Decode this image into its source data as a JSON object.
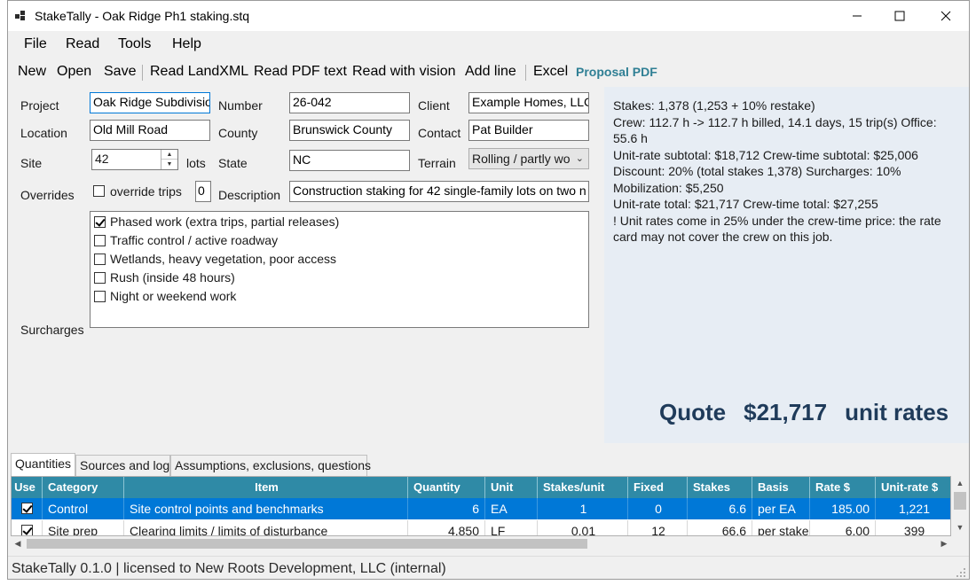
{
  "window": {
    "title": "StakeTally - Oak Ridge Ph1 staking.stq",
    "minimize_icon": "minimize-icon",
    "maximize_icon": "maximize-icon",
    "close_icon": "close-icon"
  },
  "menu": [
    "File",
    "Read",
    "Tools",
    "Help"
  ],
  "toolbar": {
    "new": "New",
    "open": "Open",
    "save": "Save",
    "read_landxml": "Read LandXML",
    "read_pdf_text": "Read PDF text",
    "read_vision": "Read with vision",
    "add_line": "Add line",
    "excel": "Excel",
    "proposal_pdf": "Proposal PDF",
    "accent_color": "#2f7f94"
  },
  "form": {
    "project_label": "Project",
    "project_value": "Oak Ridge Subdivisio",
    "number_label": "Number",
    "number_value": "26-042",
    "client_label": "Client",
    "client_value": "Example Homes, LLC",
    "location_label": "Location",
    "location_value": "Old Mill Road",
    "county_label": "County",
    "county_value": "Brunswick County",
    "contact_label": "Contact",
    "contact_value": "Pat Builder",
    "site_label": "Site",
    "site_value": "42",
    "lots_label": "lots",
    "state_label": "State",
    "state_value": "NC",
    "terrain_label": "Terrain",
    "terrain_value": "Rolling / partly wo",
    "overrides_label": "Overrides",
    "override_trips_label": "override trips",
    "override_trips_value": "0",
    "description_label": "Description",
    "description_value": "Construction staking for 42 single-family lots on two n",
    "surcharges_label": "Surcharges",
    "surcharges": [
      {
        "label": "Phased work (extra trips, partial releases)",
        "checked": true
      },
      {
        "label": "Traffic control / active roadway",
        "checked": false
      },
      {
        "label": "Wetlands, heavy vegetation, poor access",
        "checked": false
      },
      {
        "label": "Rush (inside 48 hours)",
        "checked": false
      },
      {
        "label": "Night or weekend work",
        "checked": false
      }
    ]
  },
  "summary": {
    "lines": [
      "Stakes: 1,378  (1,253 + 10% restake)",
      "Crew: 112.7 h  ->  112.7 h billed, 14.1 days, 15 trip(s)   Office: 55.6 h",
      "Unit-rate subtotal: $18,712    Crew-time subtotal: $25,006",
      "Discount: 20% (total stakes 1,378)   Surcharges: 10%",
      "Mobilization: $5,250",
      "Unit-rate total: $21,717    Crew-time total: $27,255",
      "! Unit rates come in 25% under the crew-time price: the rate card may not cover the crew on this job."
    ],
    "quote_label": "Quote",
    "quote_amount": "$21,717",
    "quote_basis": "unit rates",
    "bg_color": "#e7edf4",
    "quote_color": "#1f3b5a"
  },
  "tabs": [
    "Quantities",
    "Sources and log",
    "Assumptions, exclusions, questions"
  ],
  "grid": {
    "header_color": "#2f8aa6",
    "columns": [
      "Use",
      "Category",
      "Item",
      "Quantity",
      "Unit",
      "Stakes/unit",
      "Fixed",
      "Stakes",
      "Basis",
      "Rate $",
      "Unit-rate $"
    ],
    "rows": [
      [
        "",
        "Control",
        "Site control points and benchmarks",
        "6",
        "EA",
        "1",
        "0",
        "6.6",
        "per EA",
        "185.00",
        "1,221"
      ],
      [
        "",
        "Site prep",
        "Clearing limits / limits of disturbance",
        "4,850",
        "LF",
        "0.01",
        "12",
        "66.6",
        "per stake",
        "6.00",
        "399"
      ]
    ]
  },
  "status": {
    "text": "StakeTally 0.1.0  |  licensed to New Roots Development, LLC (internal)"
  }
}
